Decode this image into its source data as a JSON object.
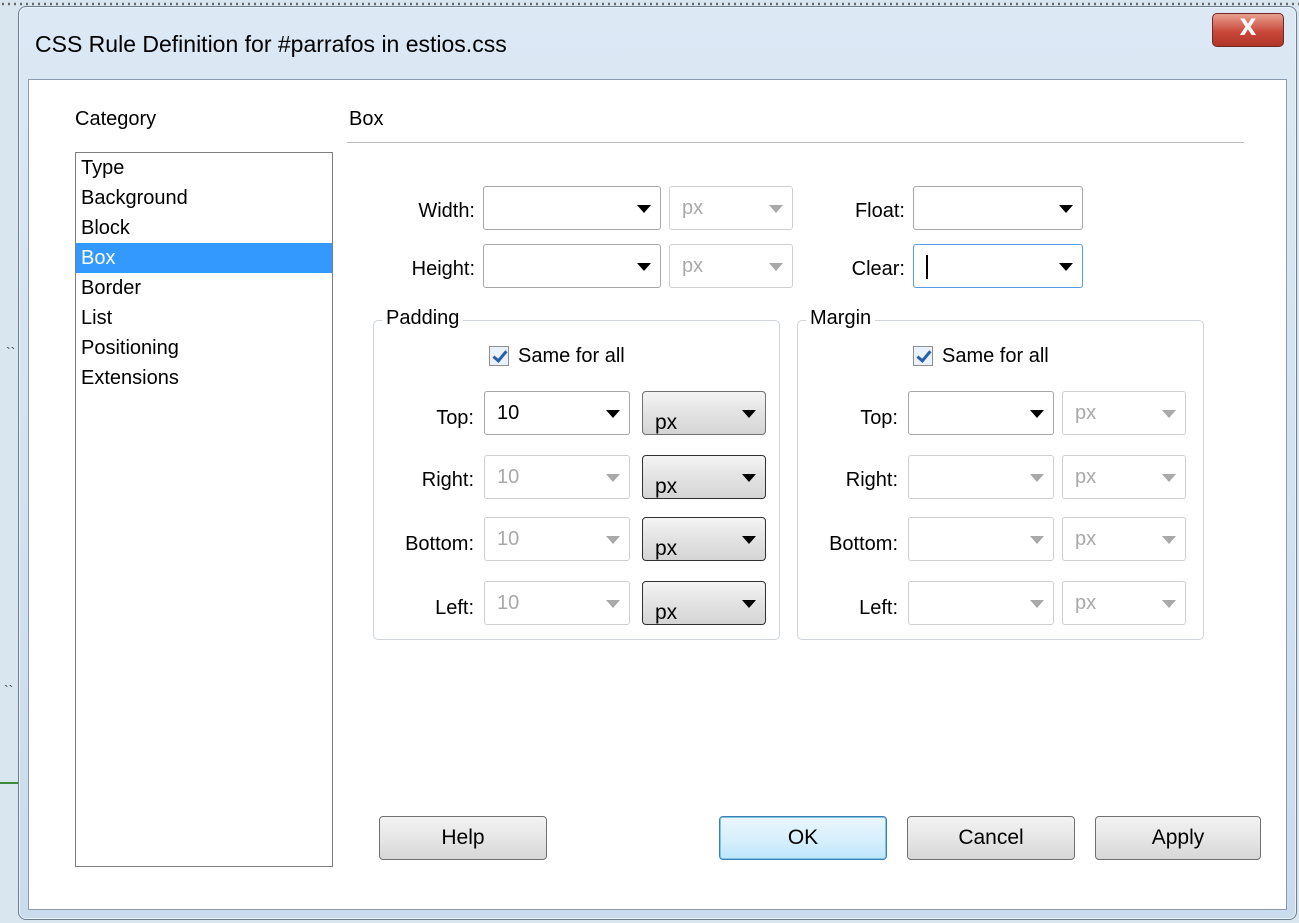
{
  "dialog": {
    "title": "CSS Rule Definition for #parrafos in estios.css",
    "close_label": "X"
  },
  "category": {
    "label": "Category",
    "items": [
      "Type",
      "Background",
      "Block",
      "Box",
      "Border",
      "List",
      "Positioning",
      "Extensions"
    ],
    "selected": "Box"
  },
  "section_title": "Box",
  "width": {
    "label": "Width:",
    "value": "",
    "unit": "px"
  },
  "height": {
    "label": "Height:",
    "value": "",
    "unit": "px"
  },
  "float": {
    "label": "Float:",
    "value": ""
  },
  "clear": {
    "label": "Clear:",
    "value": ""
  },
  "padding": {
    "title": "Padding",
    "same_for_all_label": "Same for all",
    "same_for_all": true,
    "top": {
      "label": "Top:",
      "value": "10",
      "unit": "px"
    },
    "right": {
      "label": "Right:",
      "value": "10",
      "unit": "px"
    },
    "bottom": {
      "label": "Bottom:",
      "value": "10",
      "unit": "px"
    },
    "left": {
      "label": "Left:",
      "value": "10",
      "unit": "px"
    }
  },
  "margin": {
    "title": "Margin",
    "same_for_all_label": "Same for all",
    "same_for_all": true,
    "top": {
      "label": "Top:",
      "value": "",
      "unit": "px"
    },
    "right": {
      "label": "Right:",
      "value": "",
      "unit": "px"
    },
    "bottom": {
      "label": "Bottom:",
      "value": "",
      "unit": "px"
    },
    "left": {
      "label": "Left:",
      "value": "",
      "unit": "px"
    }
  },
  "buttons": {
    "help": "Help",
    "ok": "OK",
    "cancel": "Cancel",
    "apply": "Apply"
  },
  "colors": {
    "selection": "#3399ff",
    "close_button": "#c9493a",
    "default_button": "#bee6fd"
  }
}
